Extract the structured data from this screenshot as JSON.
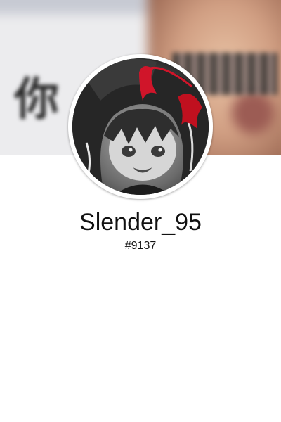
{
  "profile": {
    "username": "Slender_95",
    "discriminator": "#9137",
    "banner_text": "你",
    "avatar_icon": "anime-girl-avatar",
    "accent_color": "#d0152a"
  }
}
